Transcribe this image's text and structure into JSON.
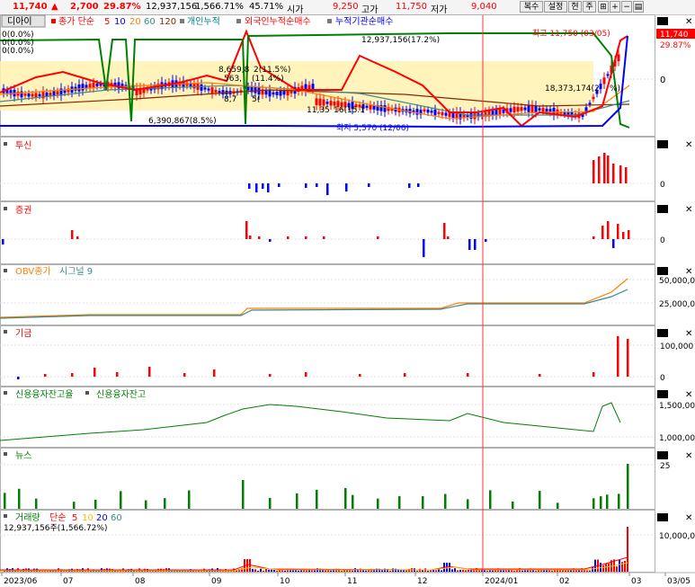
{
  "quote": {
    "price": "11,740",
    "arrow": "▲",
    "change": "2,700",
    "change_pct": "29.87%",
    "volume": "12,937,156",
    "vol_ratio": "1,566.71%",
    "turnover": "45.71%",
    "open_label": "시가",
    "open": "9,250",
    "high_label": "고가",
    "high": "11,750",
    "low_label": "저가",
    "low": "9,040"
  },
  "toolbar": {
    "copy": "복수",
    "settings": "설정",
    "current": "현",
    "note": "주"
  },
  "main_legend": {
    "tab": "디아이",
    "ma": "종가 단순",
    "p5": "5",
    "p10": "10",
    "p20": "20",
    "p60": "60",
    "p120": "120",
    "indiv": "개인누적",
    "foreign": "외국인누적순매수",
    "inst": "누적기관순매수"
  },
  "main_labels": {
    "pct_a": "0(0.0%)",
    "pct_b": "0(0.0%)",
    "pct_c": "0(0.0%)",
    "vol_high": "12,937,156(17.2%)",
    "v1": "8,659,8",
    "v1b": "2(11.5%)",
    "v2": "563,",
    "v2b": "(11.4%)",
    "v3": "8,7",
    "v3b": "5(",
    "v4": "11,35",
    "v4b": "16(15.1",
    "v5": "6,390,867(8.5%)",
    "v6": "18,373,174(2",
    "v6b": "%)",
    "max_label": "최고 11,750 (03/05)",
    "min_label": "최저 5,570 (12/06)",
    "price_tag": "11,740",
    "pct_tag": "29.87%",
    "zero": "0"
  },
  "panels": {
    "trust": "투신",
    "securities": "증권",
    "obv": "OBV종가",
    "obv_signal": "시그널 9",
    "pension": "기금",
    "credit_a": "신용융자잔고율",
    "credit_b": "신용융자잔고",
    "news": "뉴스",
    "volume": "거래량",
    "vol_ma": "단순",
    "vol_p5": "5",
    "vol_p10": "10",
    "vol_p20": "20",
    "vol_p60": "60",
    "vol_note": "12,937,156주(1,566.72%)"
  },
  "axis": {
    "trust_zero": "0",
    "sec_zero": "0",
    "obv_top": "50,000,0",
    "obv_mid": "25,000,0",
    "pen_top": "100,000",
    "pen_zero": "0",
    "cred_top": "1,500,000",
    "cred_bot": "1,000,000",
    "news_top": "25",
    "vol_top": "10,000,0"
  },
  "dates": [
    "2023/06",
    "07",
    "08",
    "09",
    "10",
    "11",
    "12",
    "2024/01",
    "02",
    "03",
    "03/05"
  ],
  "colors": {
    "up": "#ff0000",
    "down": "#0000ff",
    "green": "#008000",
    "teal": "#3a8a8a",
    "orange": "#ff8000",
    "brown": "#8b2500",
    "gold": "#ffc000",
    "band": "#fff3b0",
    "cursor": "#ff3030",
    "panel_icon": "#000000"
  }
}
